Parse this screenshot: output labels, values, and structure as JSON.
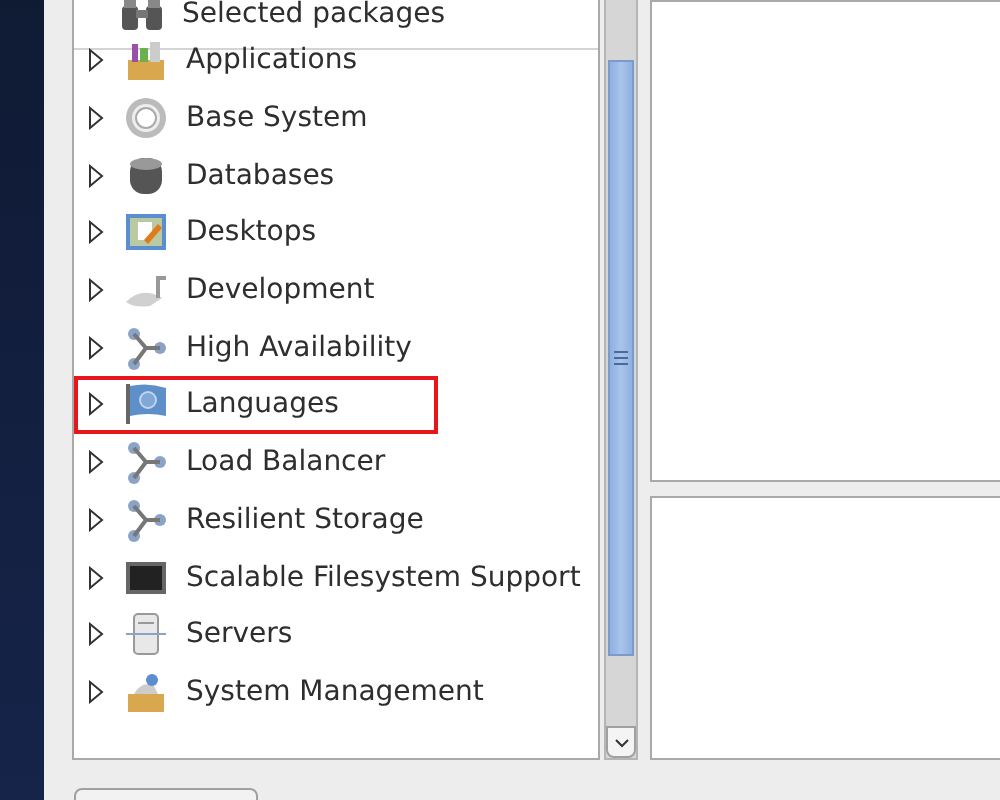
{
  "package_list": {
    "header": {
      "label": "Selected packages"
    },
    "groups": [
      {
        "label": "Applications",
        "expanded": false,
        "highlighted": false
      },
      {
        "label": "Base System",
        "expanded": false,
        "highlighted": false
      },
      {
        "label": "Databases",
        "expanded": false,
        "highlighted": false
      },
      {
        "label": "Desktops",
        "expanded": false,
        "highlighted": false
      },
      {
        "label": "Development",
        "expanded": false,
        "highlighted": false
      },
      {
        "label": "High Availability",
        "expanded": false,
        "highlighted": false
      },
      {
        "label": "Languages",
        "expanded": false,
        "highlighted": true
      },
      {
        "label": "Load Balancer",
        "expanded": false,
        "highlighted": false
      },
      {
        "label": "Resilient Storage",
        "expanded": false,
        "highlighted": false
      },
      {
        "label": "Scalable Filesystem Support",
        "expanded": false,
        "highlighted": false
      },
      {
        "label": "Servers",
        "expanded": false,
        "highlighted": false
      },
      {
        "label": "System Management",
        "expanded": false,
        "highlighted": false
      }
    ]
  }
}
